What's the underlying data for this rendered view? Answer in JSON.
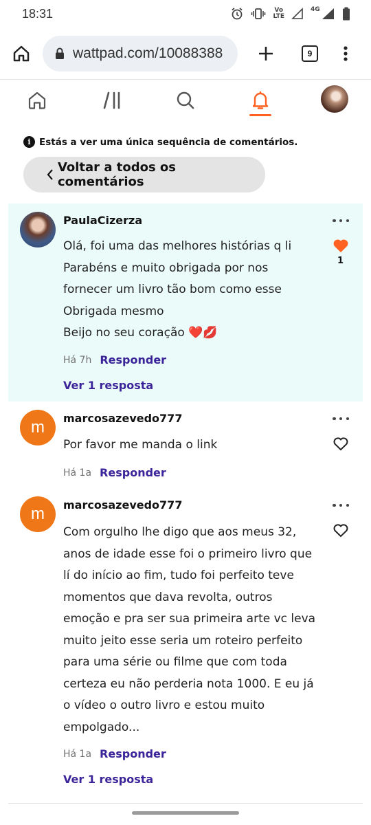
{
  "status_bar": {
    "time": "18:31",
    "icons": [
      "alarm-icon",
      "vibrate-icon",
      "volte-icon",
      "signal-icon",
      "4g-signal-icon",
      "battery-icon"
    ],
    "volte_label_top": "Vo",
    "volte_label_bottom": "LTE",
    "network_label": "4G"
  },
  "browser": {
    "url": "wattpad.com/10088388",
    "tab_count": "9",
    "icons": [
      "home-icon",
      "lock-icon",
      "plus-icon",
      "tabs-icon",
      "more-vert-icon"
    ]
  },
  "app_nav": {
    "items": [
      "home-icon",
      "library-icon",
      "search-icon",
      "bell-icon",
      "profile-avatar"
    ],
    "active": "bell-icon",
    "accent_color": "#ff6122"
  },
  "notice": {
    "text": "Estás a ver uma única sequência de comentários."
  },
  "back_button": {
    "label": "Voltar a todos os comentários"
  },
  "comments": [
    {
      "username": "PaulaCizerza",
      "avatar": "photo",
      "lines": [
        "Olá, foi uma das melhores histórias q li",
        "Parabéns e muito obrigada por nos",
        "fornecer um livro tão bom como esse",
        "Obrigada mesmo",
        "Beijo no seu coração ❤️💋"
      ],
      "time": "Há 7h",
      "reply_label": "Responder",
      "view_replies": "Ver 1 resposta",
      "liked": true,
      "like_count": "1"
    },
    {
      "username": "marcosazevedo777",
      "avatar_letter": "m",
      "lines": [
        "Por favor me manda o link"
      ],
      "time": "Há 1a",
      "reply_label": "Responder",
      "liked": false
    },
    {
      "username": "marcosazevedo777",
      "avatar_letter": "m",
      "lines": [
        "Com orgulho lhe digo que aos meus 32,",
        "anos de idade esse foi o primeiro livro que",
        "lí do início ao fim, tudo foi perfeito teve",
        "momentos que dava revolta, outros",
        "emoção e pra ser sua primeira arte vc leva",
        "muito jeito esse seria um roteiro perfeito",
        "para uma série ou filme que com toda",
        "certeza eu não perderia nota 1000. E eu já",
        "o vídeo o outro livro e estou muito",
        "empolgado..."
      ],
      "time": "Há 1a",
      "reply_label": "Responder",
      "view_replies": "Ver 1 resposta",
      "liked": false
    }
  ],
  "colors": {
    "link_purple": "#3b2399",
    "highlight_bg": "#ebfbf9",
    "avatar_orange": "#f07718",
    "heart_orange": "#ff6122"
  }
}
